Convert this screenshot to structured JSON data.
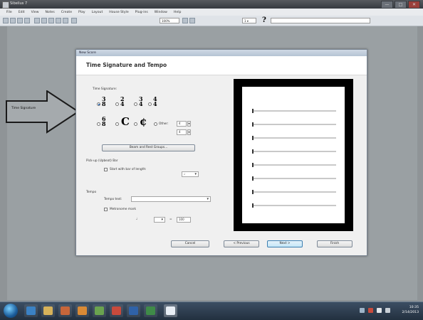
{
  "window": {
    "title": "Sibelius 7",
    "controls": [
      "—",
      "□",
      "✕"
    ]
  },
  "menubar": [
    "File",
    "Edit",
    "View",
    "Notes",
    "Create",
    "Play",
    "Layout",
    "House Style",
    "Plug-ins",
    "Window",
    "Help"
  ],
  "toolbar": {
    "zoom_value": "100%",
    "page_value": "1 ▾",
    "help_glyph": "?",
    "search_text": ""
  },
  "annotation": {
    "label": "Time Signature"
  },
  "dialog": {
    "title": "New Score",
    "heading": "Time Signature and Tempo",
    "time_signature_label": "Time Signature:",
    "time_signatures": [
      {
        "num": "3",
        "den": "8",
        "checked": true
      },
      {
        "num": "2",
        "den": "4",
        "checked": false
      },
      {
        "num": "3",
        "den": "4",
        "checked": false
      },
      {
        "num": "4",
        "den": "4",
        "checked": false
      },
      {
        "num": "6",
        "den": "8",
        "checked": false
      }
    ],
    "common_time_glyph": "C",
    "cut_time_glyph": "¢",
    "other_label": "Other:",
    "other_num": "4",
    "other_den": "4",
    "rhythm_groups_button": "Beam and Rest Groups...",
    "pickup_label": "Pick-up (Upbeat) Bar",
    "pickup_check_label": "Start with bar of length:",
    "pickup_value": "♩",
    "tempo_label": "Tempo",
    "tempo_text_label": "Tempo text:",
    "tempo_text_value": "",
    "metronome_label": "Metronome mark",
    "metronome_note": "♩",
    "metronome_eq": "=",
    "metronome_value": "100",
    "buttons": {
      "cancel": "Cancel",
      "previous": "< Previous",
      "next": "Next >",
      "finish": "Finish"
    }
  },
  "taskbar": {
    "clock_time": "10:35",
    "clock_date": "2/14/2013"
  },
  "colors": {
    "workspace_bg": "#9aa0a3",
    "taskbar_bg": "#22303f",
    "dialog_bg": "#f0f0f0"
  }
}
